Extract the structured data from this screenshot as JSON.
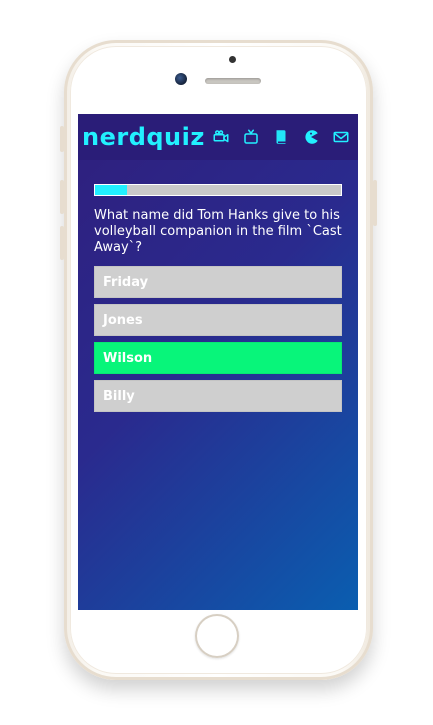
{
  "app": {
    "name": "nerdquiz"
  },
  "nav": {
    "icons": [
      {
        "name": "camera-icon"
      },
      {
        "name": "tv-icon"
      },
      {
        "name": "book-icon"
      },
      {
        "name": "pacman-icon"
      },
      {
        "name": "mail-icon"
      }
    ]
  },
  "progress": {
    "value_fraction": 0.13
  },
  "question": {
    "text": "What name did Tom Hanks give to his volleyball companion in the film `Cast Away`?"
  },
  "answers": [
    {
      "label": "Friday",
      "state": "neutral"
    },
    {
      "label": "Jones",
      "state": "neutral"
    },
    {
      "label": "Wilson",
      "state": "correct"
    },
    {
      "label": "Billy",
      "state": "neutral"
    }
  ],
  "colors": {
    "accent_cyan": "#22f0ff",
    "correct_green": "#08f57a",
    "neutral_answer": "#cfcfcf",
    "header_purple": "#2a1d78"
  }
}
